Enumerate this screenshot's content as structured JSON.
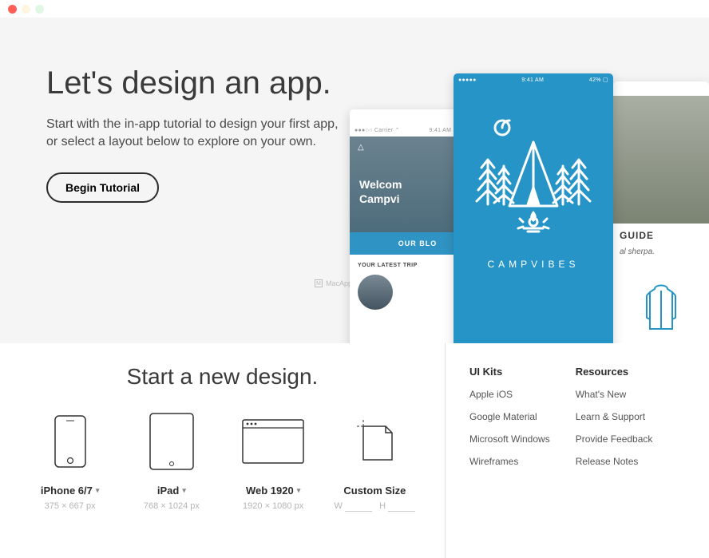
{
  "hero": {
    "title": "Let's design an app.",
    "subtitle": "Start with the in-app tutorial to design your first app, or select a layout below to explore on your own.",
    "begin_label": "Begin Tutorial"
  },
  "watermark": "MacAppStore.net",
  "mockups": {
    "m1": {
      "carrier": "●●●○○ Carrier ⌃",
      "time": "9:41 AM",
      "welcome1": "Welcom",
      "welcome2": "Campvi",
      "blog": "OUR BLO",
      "trip_label": "YOUR LATEST TRIP"
    },
    "m2": {
      "time": "9:41 AM",
      "battery": "42% ▢",
      "brand": "CAMPVIBES"
    },
    "m3": {
      "guide": "GUIDE",
      "sherpa": "al sherpa."
    }
  },
  "startnew": {
    "title": "Start a new design.",
    "devices": [
      {
        "label": "iPhone 6/7",
        "dims": "375 × 667 px"
      },
      {
        "label": "iPad",
        "dims": "768 × 1024 px"
      },
      {
        "label": "Web 1920",
        "dims": "1920 × 1080 px"
      },
      {
        "label": "Custom Size",
        "w_label": "W",
        "h_label": "H"
      }
    ]
  },
  "sidebar": {
    "uikits_title": "UI Kits",
    "uikits": [
      "Apple iOS",
      "Google Material",
      "Microsoft Windows",
      "Wireframes"
    ],
    "resources_title": "Resources",
    "resources": [
      "What's New",
      "Learn & Support",
      "Provide Feedback",
      "Release Notes"
    ]
  }
}
